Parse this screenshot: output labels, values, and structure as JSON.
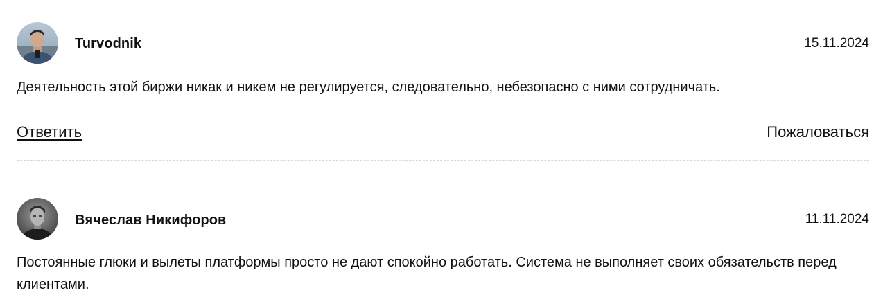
{
  "reviews": [
    {
      "author": "Turvodnik",
      "date": "15.11.2024",
      "text": "Деятельность этой биржи никак и никем не регулируется, следовательно, небезопасно с ними сотрудничать.",
      "avatar": "user-avatar-photo",
      "reply_label": "Ответить",
      "report_label": "Пожаловаться"
    },
    {
      "author": "Вячеслав Никифоров",
      "date": "11.11.2024",
      "text": "Постоянные глюки и вылеты платформы просто не дают спокойно работать. Система не выполняет своих обязательств перед клиентами.",
      "avatar": "user-avatar-photo"
    }
  ],
  "colors": {
    "text": "#111111",
    "divider": "#d6d6d6",
    "background": "#ffffff"
  }
}
